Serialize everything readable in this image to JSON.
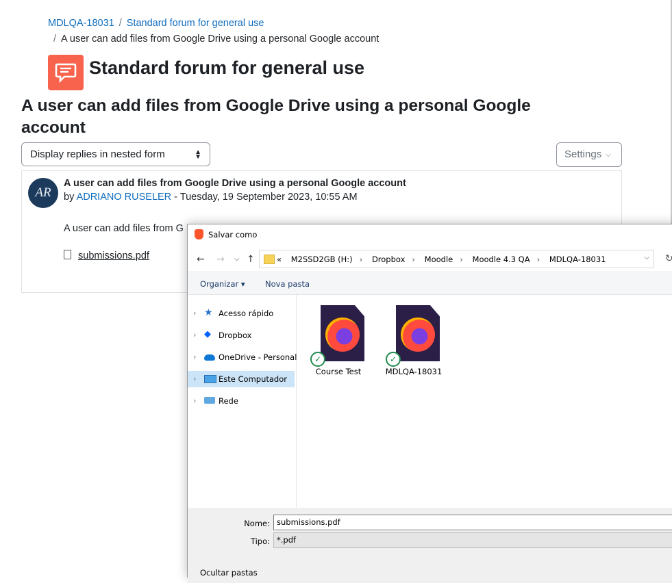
{
  "breadcrumb": {
    "items": [
      "MDLQA-18031",
      "Standard forum for general use"
    ],
    "current": "A user can add files from Google Drive using a personal Google account"
  },
  "forum": {
    "title": "Standard forum for general use",
    "icon": "forum-icon",
    "icon_color": "#f7634d"
  },
  "discussion": {
    "title": "A user can add files from Google Drive using a personal Google account",
    "display_mode": "Display replies in nested form",
    "settings_label": "Settings"
  },
  "post": {
    "avatar_initials": "AR",
    "subject": "A user can add files from Google Drive using a personal Google account",
    "by": "by",
    "author": "ADRIANO RUSELER",
    "date": " - Tuesday, 19 September 2023, 10:55 AM",
    "message": "A user can add files from G",
    "attachment": "submissions.pdf"
  },
  "dialog": {
    "title": "Salvar como",
    "path": [
      "«",
      "M2SSD2GB (H:)",
      "Dropbox",
      "Moodle",
      "Moodle 4.3 QA",
      "MDLQA-18031"
    ],
    "organize": "Organizar ▾",
    "new_folder": "Nova pasta",
    "nav_items": [
      "Acesso rápido",
      "Dropbox",
      "OneDrive - Personal",
      "Este Computador",
      "Rede"
    ],
    "selected_nav": "Este Computador",
    "files": [
      "Course Test",
      "MDLQA-18031"
    ],
    "name_label": "Nome:",
    "name_value": "submissions.pdf",
    "type_label": "Tipo:",
    "type_value": "*.pdf",
    "hide_folders": "Ocultar pastas"
  }
}
